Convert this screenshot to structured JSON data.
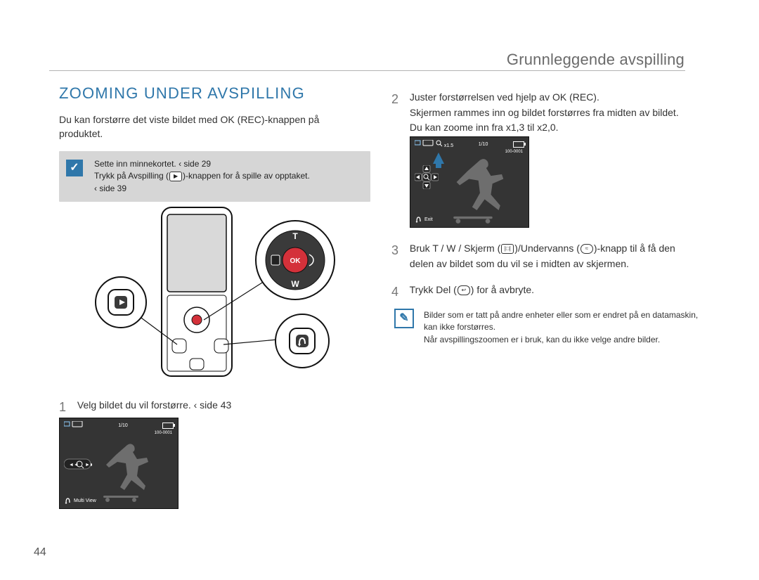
{
  "header": {
    "breadcrumb": "Grunnleggende avspilling"
  },
  "title": "ZOOMING UNDER AVSPILLING",
  "intro": "Du kan forstørre det viste bildet med OK (REC)-knappen på produktet.",
  "note1": {
    "line1": "Sette inn minnekortet. ‹ side 29",
    "line2_a": "Trykk på Avspilling (",
    "line2_b": ")-knappen for å spille av opptaket.",
    "line3": "‹ side 39"
  },
  "steps": {
    "s1": {
      "num": "1",
      "text": "Velg bildet du vil forstørre. ‹ side 43"
    },
    "s2": {
      "num": "2",
      "line1": "Juster forstørrelsen ved hjelp av OK (REC).",
      "line2": "Skjermen rammes inn og bildet forstørres fra midten av bildet. Du kan zoome inn fra x1,3 til x2,0."
    },
    "s3": {
      "num": "3",
      "line_a": "Bruk T / W / Skjerm (",
      "line_b": ")/Undervanns (",
      "line_c": ")-knapp til å få den delen av bildet som du vil se i midten av skjermen."
    },
    "s4": {
      "num": "4",
      "line_a": "Trykk Del (",
      "line_b": ") for å avbryte."
    }
  },
  "note2": {
    "line1": "Bilder som er tatt på andre enheter eller som er endret på en datamaskin, kan ikke forstørres.",
    "line2": "Når avspillingszoomen er i bruk, kan du ikke velge andre bilder."
  },
  "lcd": {
    "counter": "1/10",
    "filecode": "100-0001",
    "multiview": "Multi View",
    "exit": "Exit",
    "zoom": "x1.5"
  },
  "device": {
    "ok_label": "OK",
    "t_label": "T",
    "w_label": "W"
  },
  "page_number": "44"
}
